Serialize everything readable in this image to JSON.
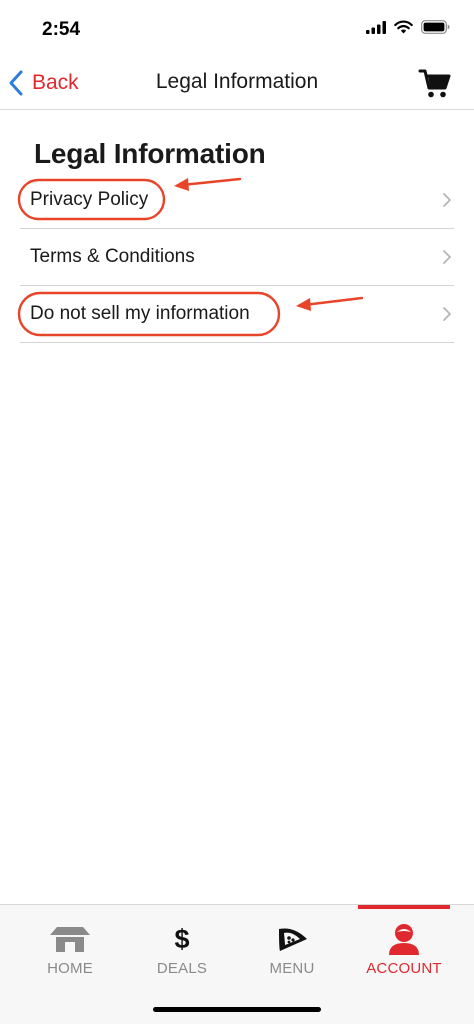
{
  "status_bar": {
    "time": "2:54",
    "icons": [
      "signal-icon",
      "wifi-icon",
      "battery-icon"
    ]
  },
  "nav": {
    "back_label": "Back",
    "title": "Legal Information",
    "cart_icon": "cart-icon"
  },
  "page": {
    "title": "Legal Information",
    "items": [
      {
        "label": "Privacy Policy",
        "icon": "chevron-right-icon"
      },
      {
        "label": "Terms & Conditions",
        "icon": "chevron-right-icon"
      },
      {
        "label": "Do not sell my information",
        "icon": "chevron-right-icon"
      }
    ]
  },
  "annotations": {
    "color": "#e8442a",
    "highlighted_items": [
      "Privacy Policy",
      "Do not sell my information"
    ]
  },
  "tabs": [
    {
      "label": "HOME",
      "icon": "home-icon",
      "active": false
    },
    {
      "label": "DEALS",
      "icon": "dollar-icon",
      "active": false
    },
    {
      "label": "MENU",
      "icon": "pizza-icon",
      "active": false
    },
    {
      "label": "ACCOUNT",
      "icon": "account-icon",
      "active": true
    }
  ],
  "colors": {
    "accent": "#e0282f",
    "back_chevron": "#2f7ce0",
    "inactive_tab": "#8a8a8a"
  }
}
